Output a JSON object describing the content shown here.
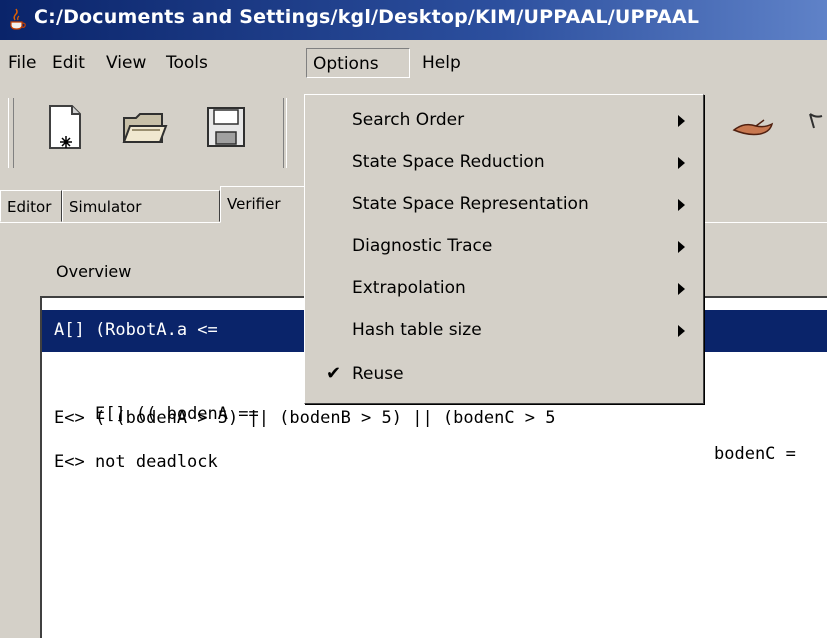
{
  "window": {
    "title": "C:/Documents and Settings/kgl/Desktop/KIM/UPPAAL/UPPAAL"
  },
  "menubar": {
    "file": "File",
    "edit": "Edit",
    "view": "View",
    "tools": "Tools",
    "options": "Options",
    "help": "Help"
  },
  "tabs": {
    "editor": "Editor",
    "simulator": "Simulator",
    "verifier": "Verifier"
  },
  "verifier": {
    "overview_label": "Overview",
    "queries": [
      "A[] (RobotA.a <=",
      "E[] (( bodenA ==",
      "E<> ( (bodenA > 5) || (bodenB > 5) || (bodenC > 5",
      "E<> not deadlock"
    ],
    "query_tail_row2": "bodenC ="
  },
  "options_menu": {
    "items": [
      {
        "label": "Search Order",
        "submenu": true
      },
      {
        "label": "State Space Reduction",
        "submenu": true
      },
      {
        "label": "State Space Representation",
        "submenu": true
      },
      {
        "label": "Diagnostic Trace",
        "submenu": true
      },
      {
        "label": "Extrapolation",
        "submenu": true
      },
      {
        "label": "Hash table size",
        "submenu": true
      },
      {
        "label": "Reuse",
        "checked": true
      }
    ]
  },
  "icons": [
    "java-cup-icon",
    "new-file-icon",
    "open-folder-icon",
    "save-disk-icon",
    "hand-pointer-icon"
  ],
  "colors": {
    "title_bar": "#0a246a",
    "selection": "#0a246a",
    "chrome": "#d4d0c8"
  }
}
